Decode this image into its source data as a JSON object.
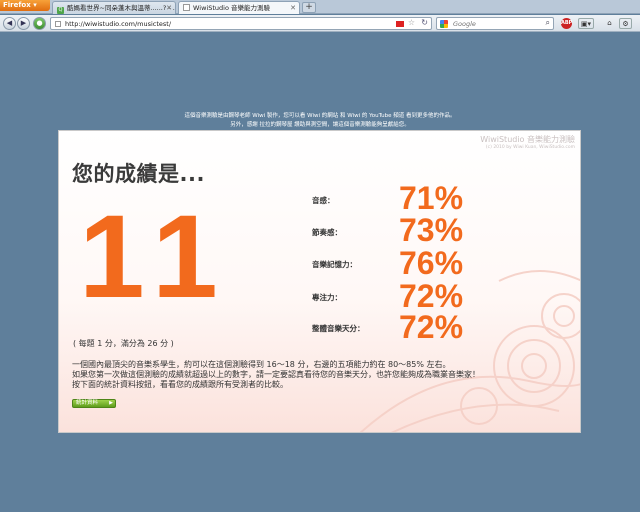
{
  "browser": {
    "app_button": "Firefox",
    "tabs": [
      {
        "label": "酷媽看世界~同朵蓬木與溫蒂......? - ..."
      },
      {
        "label": "WiwiStudio 音樂能力測驗"
      }
    ],
    "url": "http://wiwistudio.com/musictest/",
    "search_placeholder": "Google"
  },
  "intro": {
    "line1": "這個音樂測驗是由鋼琴老師 Wiwi 製作，您可以看 Wiwi 的網站 和 Wiwi 的 YouTube 頻道 看到更多他的作品。",
    "line2": "另外，感謝 拉拉的鋼琴屋 讚助與測空間，讓這個音樂測驗能夠呈獻給您。"
  },
  "card": {
    "brand_title": "WiwiStudio 音樂能力測驗",
    "brand_copy": "(c) 2010 by Wiwi Kuan, WiwiStudio.com",
    "heading": "您的成績是...",
    "score": "11",
    "score_note": "( 每題 1 分，滿分為 26 分 )",
    "stats": [
      {
        "label": "音感：",
        "value": "71%"
      },
      {
        "label": "節奏感：",
        "value": "73%"
      },
      {
        "label": "音樂記憶力：",
        "value": "76%"
      },
      {
        "label": "專注力：",
        "value": "72%"
      },
      {
        "label": "整體音樂天分：",
        "value": "72%"
      }
    ],
    "paragraphs": [
      "一個國內最頂尖的音樂系學生，約可以在這個測驗得到 16～18 分，右邊的五項能力約在 80～85% 左右。",
      "如果您第一次做這個測驗的成績就超過以上的數字，請一定要認真看待您的音樂天分，也許您能夠成為職業音樂家！",
      "按下面的統計資料按鈕，看看您的成績跟所有受測者的比較。"
    ],
    "stats_button": "統計資料"
  },
  "colors": {
    "accent": "#f26a1d",
    "page_bg": "#5f7f9b",
    "button_green": "#6aaa22"
  }
}
